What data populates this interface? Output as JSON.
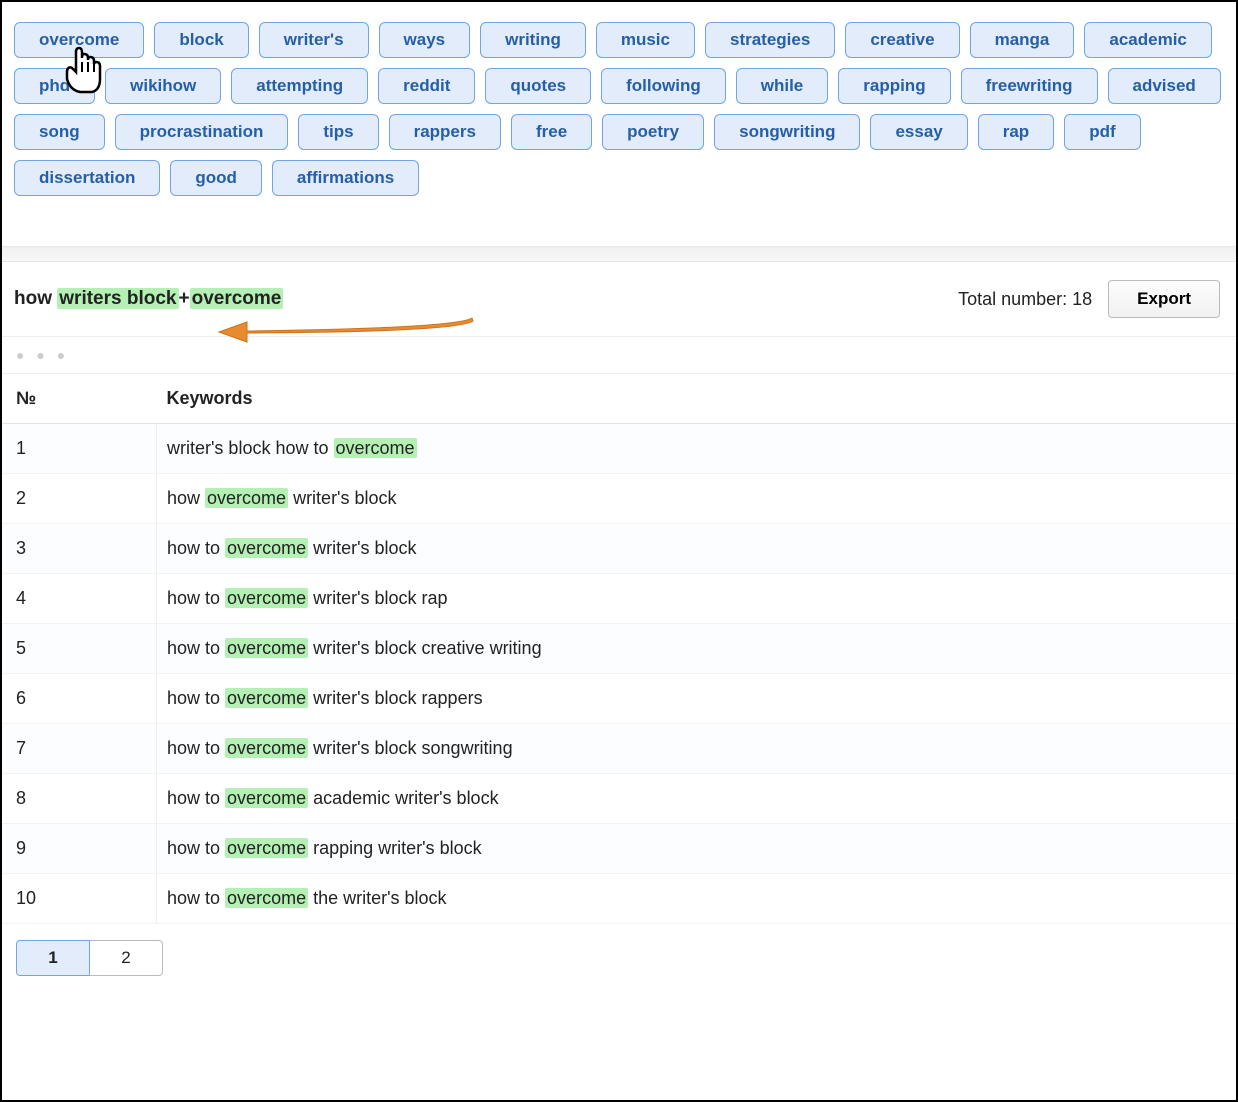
{
  "tags": [
    "overcome",
    "block",
    "writer's",
    "ways",
    "writing",
    "music",
    "strategies",
    "creative",
    "manga",
    "academic",
    "phd",
    "wikihow",
    "attempting",
    "reddit",
    "quotes",
    "following",
    "while",
    "rapping",
    "freewriting",
    "advised",
    "song",
    "procrastination",
    "tips",
    "rappers",
    "free",
    "poetry",
    "songwriting",
    "essay",
    "rap",
    "pdf",
    "dissertation",
    "good",
    "affirmations"
  ],
  "query": {
    "prefix": "how ",
    "hl1": "writers block",
    "plus": "+",
    "hl2": "overcome"
  },
  "total_label": "Total number: ",
  "total_count": "18",
  "export_label": "Export",
  "table": {
    "col_num": "№",
    "col_kw": "Keywords",
    "rows": [
      {
        "n": "1",
        "pre": "writer's block how to ",
        "hl": "overcome",
        "post": ""
      },
      {
        "n": "2",
        "pre": "how ",
        "hl": "overcome",
        "post": " writer's block"
      },
      {
        "n": "3",
        "pre": "how to ",
        "hl": "overcome",
        "post": " writer's block"
      },
      {
        "n": "4",
        "pre": "how to ",
        "hl": "overcome",
        "post": " writer's block rap"
      },
      {
        "n": "5",
        "pre": "how to ",
        "hl": "overcome",
        "post": " writer's block creative writing"
      },
      {
        "n": "6",
        "pre": "how to ",
        "hl": "overcome",
        "post": " writer's block rappers"
      },
      {
        "n": "7",
        "pre": "how to ",
        "hl": "overcome",
        "post": " writer's block songwriting"
      },
      {
        "n": "8",
        "pre": "how to ",
        "hl": "overcome",
        "post": " academic writer's block"
      },
      {
        "n": "9",
        "pre": "how to ",
        "hl": "overcome",
        "post": " rapping writer's block"
      },
      {
        "n": "10",
        "pre": "how to ",
        "hl": "overcome",
        "post": " the writer's block"
      }
    ]
  },
  "pager": {
    "pages": [
      "1",
      "2"
    ],
    "active": "1"
  },
  "dots": "● ● ●"
}
